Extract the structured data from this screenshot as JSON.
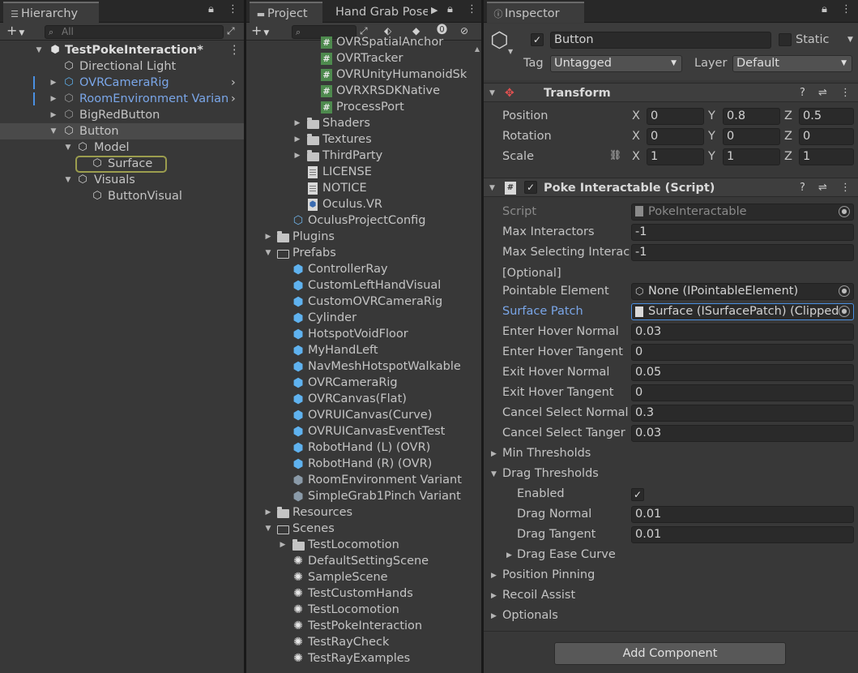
{
  "hierarchy": {
    "tab": "Hierarchy",
    "search_placeholder": "All",
    "scene": "TestPokeInteraction*",
    "items": [
      {
        "label": "Directional Light",
        "icon": "cube-icon"
      },
      {
        "label": "OVRCameraRig",
        "icon": "prefab-icon"
      },
      {
        "label": "RoomEnvironment Varian",
        "icon": "prefab-icon"
      },
      {
        "label": "BigRedButton",
        "icon": "prefab-icon"
      },
      {
        "label": "Button",
        "icon": "cube-icon"
      },
      {
        "label": "Model",
        "icon": "cube-icon"
      },
      {
        "label": "Surface",
        "icon": "cube-icon"
      },
      {
        "label": "Visuals",
        "icon": "cube-icon"
      },
      {
        "label": "ButtonVisual",
        "icon": "cube-icon"
      }
    ]
  },
  "project": {
    "tab": "Project",
    "tab2": "Hand Grab Pose",
    "items": [
      {
        "label": "OVRSpatialAnchor",
        "icon": "script-icon"
      },
      {
        "label": "OVRTracker",
        "icon": "script-icon"
      },
      {
        "label": "OVRUnityHumanoidSk",
        "icon": "script-icon"
      },
      {
        "label": "OVRXRSDKNative",
        "icon": "script-icon"
      },
      {
        "label": "ProcessPort",
        "icon": "script-icon"
      },
      {
        "label": "Shaders",
        "icon": "folder-icon"
      },
      {
        "label": "Textures",
        "icon": "folder-icon"
      },
      {
        "label": "ThirdParty",
        "icon": "folder-icon"
      },
      {
        "label": "LICENSE",
        "icon": "document-icon"
      },
      {
        "label": "NOTICE",
        "icon": "document-icon"
      },
      {
        "label": "Oculus.VR",
        "icon": "assembly-icon"
      },
      {
        "label": "OculusProjectConfig",
        "icon": "config-icon"
      },
      {
        "label": "Plugins",
        "icon": "folder-icon"
      },
      {
        "label": "Prefabs",
        "icon": "folder-open-icon"
      },
      {
        "label": "ControllerRay",
        "icon": "prefab-icon"
      },
      {
        "label": "CustomLeftHandVisual",
        "icon": "prefab-icon"
      },
      {
        "label": "CustomOVRCameraRig",
        "icon": "prefab-icon"
      },
      {
        "label": "Cylinder",
        "icon": "prefab-icon"
      },
      {
        "label": "HotspotVoidFloor",
        "icon": "prefab-icon"
      },
      {
        "label": "MyHandLeft",
        "icon": "prefab-icon"
      },
      {
        "label": "NavMeshHotspotWalkable",
        "icon": "prefab-icon"
      },
      {
        "label": "OVRCameraRig",
        "icon": "prefab-icon"
      },
      {
        "label": "OVRCanvas(Flat)",
        "icon": "prefab-icon"
      },
      {
        "label": "OVRUICanvas(Curve)",
        "icon": "prefab-icon"
      },
      {
        "label": "OVRUICanvasEventTest",
        "icon": "prefab-icon"
      },
      {
        "label": "RobotHand (L) (OVR)",
        "icon": "prefab-icon"
      },
      {
        "label": "RobotHand (R) (OVR)",
        "icon": "prefab-icon"
      },
      {
        "label": "RoomEnvironment Variant",
        "icon": "prefab-variant-icon"
      },
      {
        "label": "SimpleGrab1Pinch Variant",
        "icon": "prefab-variant-icon"
      },
      {
        "label": "Resources",
        "icon": "folder-icon"
      },
      {
        "label": "Scenes",
        "icon": "folder-open-icon"
      },
      {
        "label": "TestLocomotion",
        "icon": "folder-icon"
      },
      {
        "label": "DefaultSettingScene",
        "icon": "unity-scene-icon"
      },
      {
        "label": "SampleScene",
        "icon": "unity-scene-icon"
      },
      {
        "label": "TestCustomHands",
        "icon": "unity-scene-icon"
      },
      {
        "label": "TestLocomotion",
        "icon": "unity-scene-icon"
      },
      {
        "label": "TestPokeInteraction",
        "icon": "unity-scene-icon"
      },
      {
        "label": "TestRayCheck",
        "icon": "unity-scene-icon"
      },
      {
        "label": "TestRayExamples",
        "icon": "unity-scene-icon"
      }
    ]
  },
  "inspector": {
    "tab": "Inspector",
    "object_name": "Button",
    "static_label": "Static",
    "tag_label": "Tag",
    "tag_value": "Untagged",
    "layer_label": "Layer",
    "layer_value": "Default",
    "transform": {
      "title": "Transform",
      "position_label": "Position",
      "rotation_label": "Rotation",
      "scale_label": "Scale",
      "x": "X",
      "y": "Y",
      "z": "Z",
      "position": [
        "0",
        "0.8",
        "0.5"
      ],
      "rotation": [
        "0",
        "0",
        "0"
      ],
      "scale": [
        "1",
        "1",
        "1"
      ]
    },
    "poke": {
      "title": "Poke Interactable (Script)",
      "script_label": "Script",
      "script_value": "PokeInteractable",
      "max_interactors_label": "Max Interactors",
      "max_interactors": "-1",
      "max_selecting_label": "Max Selecting Interac",
      "max_selecting": "-1",
      "optional_label": "[Optional]",
      "pointable_label": "Pointable Element",
      "pointable_value": "None (IPointableElement)",
      "surface_label": "Surface Patch",
      "surface_value": "Surface (ISurfacePatch) (Clipped",
      "enter_hover_normal_label": "Enter Hover Normal",
      "enter_hover_normal": "0.03",
      "enter_hover_tangent_label": "Enter Hover Tangent",
      "enter_hover_tangent": "0",
      "exit_hover_normal_label": "Exit Hover Normal",
      "exit_hover_normal": "0.05",
      "exit_hover_tangent_label": "Exit Hover Tangent",
      "exit_hover_tangent": "0",
      "cancel_normal_label": "Cancel Select Normal",
      "cancel_normal": "0.3",
      "cancel_tangent_label": "Cancel Select Tanger",
      "cancel_tangent": "0.03",
      "min_thresholds": "Min Thresholds",
      "drag_thresholds": "Drag Thresholds",
      "enabled_label": "Enabled",
      "drag_normal_label": "Drag Normal",
      "drag_normal": "0.01",
      "drag_tangent_label": "Drag Tangent",
      "drag_tangent": "0.01",
      "drag_ease_label": "Drag Ease Curve",
      "position_pinning": "Position Pinning",
      "recoil_assist": "Recoil Assist",
      "optionals": "Optionals"
    },
    "add_component": "Add Component"
  }
}
